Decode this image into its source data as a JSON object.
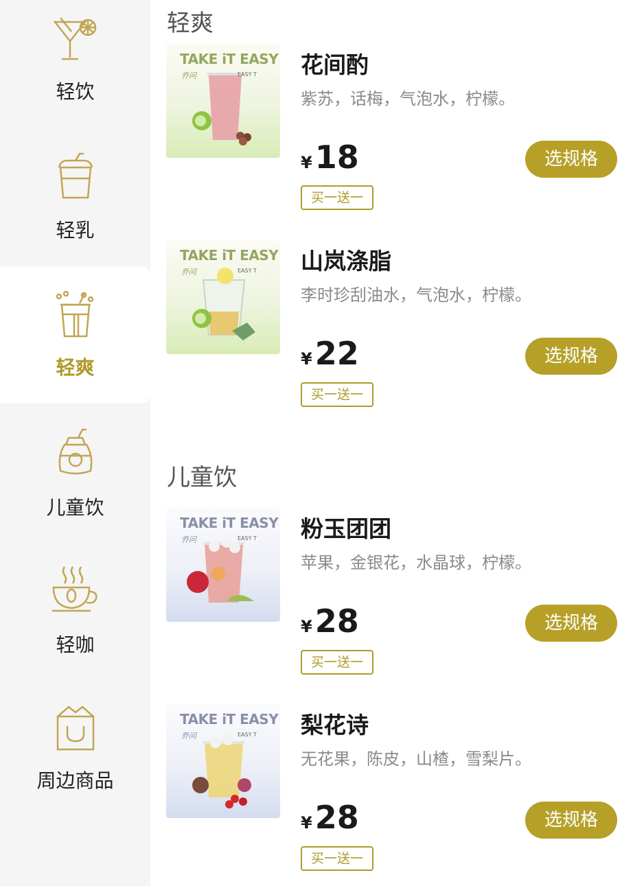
{
  "sidebar": {
    "items": [
      {
        "label": "轻饮",
        "icon": "cocktail-icon"
      },
      {
        "label": "轻乳",
        "icon": "milk-cup-icon"
      },
      {
        "label": "轻爽",
        "icon": "bubble-cup-icon",
        "active": true
      },
      {
        "label": "儿童饮",
        "icon": "kids-bottle-icon"
      },
      {
        "label": "轻咖",
        "icon": "coffee-cup-icon"
      },
      {
        "label": "周边商品",
        "icon": "shopping-bag-icon"
      }
    ]
  },
  "colors": {
    "accent": "#b6a027",
    "active_text": "#b09a2a",
    "sidebar_bg": "#f5f5f5"
  },
  "sections": [
    {
      "title": "轻爽",
      "products": [
        {
          "name": "花间酌",
          "desc": "紫苏，话梅，气泡水，柠檬。",
          "currency": "¥",
          "price": "18",
          "promo": "买一送一",
          "button": "选规格",
          "thumb": {
            "brand": "TAKE iT EASY",
            "sub1": "乔问",
            "sub2": "EASY T",
            "theme": "green"
          }
        },
        {
          "name": "山岚涤脂",
          "desc": "李时珍刮油水，气泡水，柠檬。",
          "currency": "¥",
          "price": "22",
          "promo": "买一送一",
          "button": "选规格",
          "thumb": {
            "brand": "TAKE iT EASY",
            "sub1": "乔问",
            "sub2": "EASY T",
            "theme": "green"
          }
        }
      ]
    },
    {
      "title": "儿童饮",
      "products": [
        {
          "name": "粉玉团团",
          "desc": "苹果，金银花，水晶球，柠檬。",
          "currency": "¥",
          "price": "28",
          "promo": "买一送一",
          "button": "选规格",
          "thumb": {
            "brand": "TAKE iT EASY",
            "sub1": "乔问",
            "sub2": "EASY T",
            "theme": "blue"
          }
        },
        {
          "name": "梨花诗",
          "desc": "无花果，陈皮，山楂，雪梨片。",
          "currency": "¥",
          "price": "28",
          "promo": "买一送一",
          "button": "选规格",
          "thumb": {
            "brand": "TAKE iT EASY",
            "sub1": "乔问",
            "sub2": "EASY T",
            "theme": "blue"
          }
        }
      ]
    }
  ]
}
